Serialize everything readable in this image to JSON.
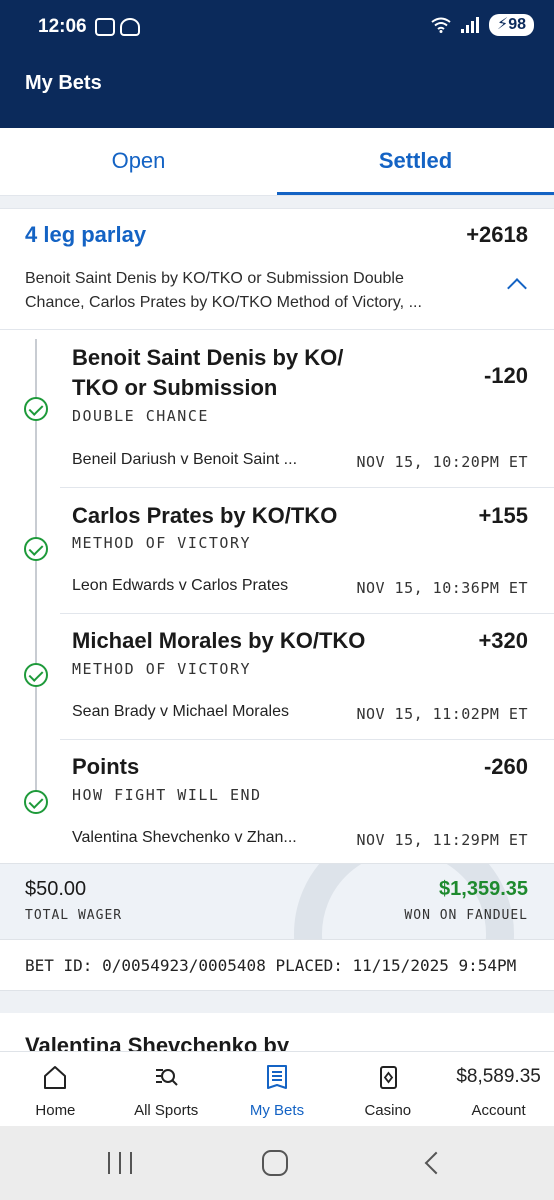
{
  "status_bar": {
    "time": "12:06",
    "battery": "98",
    "network": "6"
  },
  "header": {
    "title": "My Bets"
  },
  "tabs": [
    {
      "label": "Open",
      "active": false
    },
    {
      "label": "Settled",
      "active": true
    }
  ],
  "parlay": {
    "title": "4 leg parlay",
    "odds": "+2618",
    "description": "Benoit Saint Denis by KO/TKO or Submission Double Chance, Carlos Prates by KO/TKO Method of Victory, ...",
    "legs": [
      {
        "title": "Benoit Saint Denis by KO/ TKO or Submission",
        "odds": "-120",
        "market": "DOUBLE CHANCE",
        "event": "Beneil Dariush v Benoit Saint ...",
        "time": "NOV 15, 10:20PM ET",
        "status": "won"
      },
      {
        "title": "Carlos Prates by KO/TKO",
        "odds": "+155",
        "market": "METHOD OF VICTORY",
        "event": "Leon Edwards v Carlos Prates",
        "time": "NOV 15, 10:36PM ET",
        "status": "won"
      },
      {
        "title": "Michael Morales by KO/TKO",
        "odds": "+320",
        "market": "METHOD OF VICTORY",
        "event": "Sean Brady v Michael Morales",
        "time": "NOV 15, 11:02PM ET",
        "status": "won"
      },
      {
        "title": "Points",
        "odds": "-260",
        "market": "HOW FIGHT WILL END",
        "event": "Valentina Shevchenko v Zhan...",
        "time": "NOV 15, 11:29PM ET",
        "status": "won"
      }
    ],
    "wager_amount": "$50.00",
    "wager_label": "TOTAL WAGER",
    "won_amount": "$1,359.35",
    "won_label": "WON ON FANDUEL",
    "bet_id_line": "BET ID: 0/0054923/0005408 PLACED: 11/15/2025 9:54PM"
  },
  "next_card": {
    "title": "Valentina Shevchenko by"
  },
  "bottom_nav": [
    {
      "label": "Home",
      "icon": "home-icon"
    },
    {
      "label": "All Sports",
      "icon": "search-sports-icon"
    },
    {
      "label": "My Bets",
      "icon": "betslip-icon",
      "active": true
    },
    {
      "label": "Casino",
      "icon": "cards-icon"
    },
    {
      "label": "Account",
      "balance": "$8,589.35"
    }
  ],
  "colors": {
    "header_bg": "#0b2a5b",
    "accent": "#1463c4",
    "win": "#1e8a2e"
  }
}
